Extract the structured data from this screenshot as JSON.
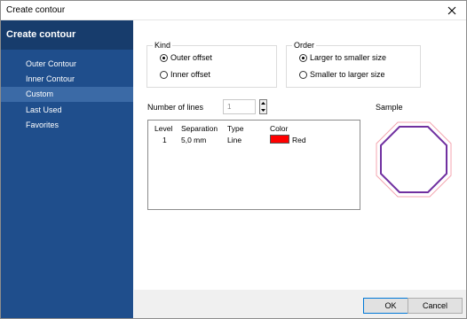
{
  "window": {
    "title": "Create contour"
  },
  "sidebar": {
    "header": "Create contour",
    "items": [
      {
        "label": "Outer Contour"
      },
      {
        "label": "Inner Contour"
      },
      {
        "label": "Custom",
        "active": true
      },
      {
        "label": "Last Used"
      },
      {
        "label": "Favorites"
      }
    ]
  },
  "kind": {
    "legend": "Kind",
    "options": [
      {
        "label": "Outer offset",
        "selected": true
      },
      {
        "label": "Inner offset",
        "selected": false
      }
    ]
  },
  "order": {
    "legend": "Order",
    "options": [
      {
        "label": "Larger to smaller size",
        "selected": true
      },
      {
        "label": "Smaller to larger size",
        "selected": false
      }
    ]
  },
  "lines": {
    "label": "Number of lines",
    "value": "1"
  },
  "sample": {
    "label": "Sample"
  },
  "table": {
    "headers": [
      "Level",
      "Separation",
      "Type",
      "Color"
    ],
    "rows": [
      {
        "level": "1",
        "separation": "5,0 mm",
        "type": "Line",
        "color_name": "Red",
        "color_hex": "#ff0000"
      }
    ]
  },
  "buttons": {
    "ok": "OK",
    "cancel": "Cancel"
  },
  "colors": {
    "sidebar": "#1f4e8c",
    "sidebar_header": "#173c6c",
    "sidebar_active": "#3b6aa6",
    "outline_purple": "#7030a0",
    "outline_pink": "#f4a6b0"
  },
  "icons": [
    "close-icon",
    "spin-up-icon",
    "spin-down-icon"
  ]
}
